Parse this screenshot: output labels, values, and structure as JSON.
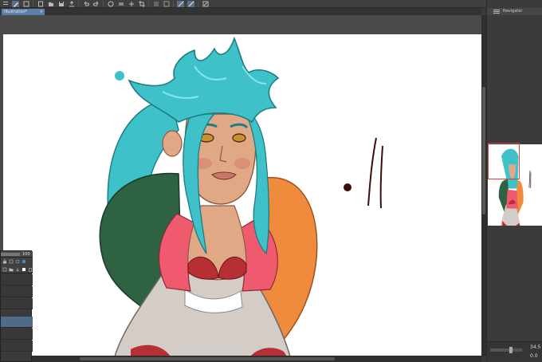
{
  "document": {
    "tab_label": "Illustration*",
    "close_glyph": "×"
  },
  "navigator": {
    "title": "Navigator",
    "zoom": "34.5",
    "angle": "0.0"
  },
  "layer_panel": {
    "opacity": "100"
  },
  "toolbar": {
    "icons": [
      "new-icon",
      "open-icon",
      "save-icon",
      "undo-icon",
      "redo-icon",
      "clear-icon",
      "crop-icon",
      "transform-icon",
      "view-icon",
      "pen-icon",
      "snap-icon",
      "ruler-icon"
    ]
  },
  "colors": {
    "workspace": "#3a3a3a",
    "paper": "#ffffff",
    "accent": "#5b7fa6",
    "hair": "#3ec1c9",
    "skin": "#e0a884",
    "green_sleeve": "#2f6143",
    "orange_sleeve": "#f08a3c",
    "pink": "#ef5a6f",
    "red": "#b82e35",
    "gray_suit": "#d4ccc6"
  }
}
